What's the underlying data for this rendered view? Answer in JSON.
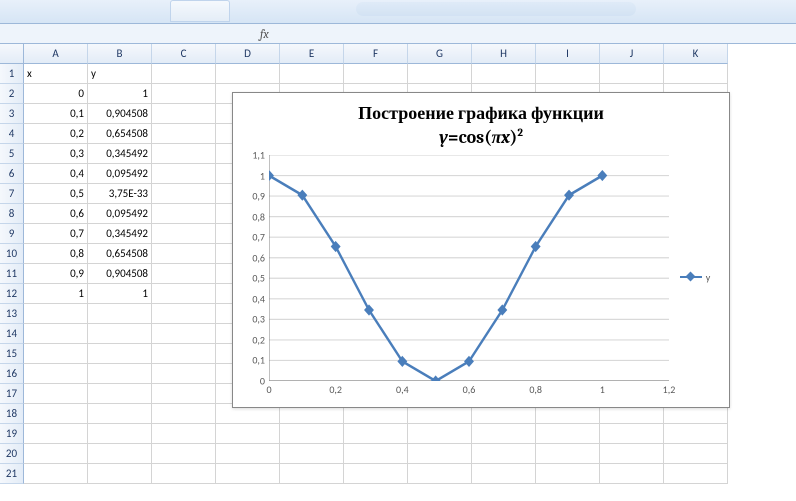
{
  "formula_bar_label": "fx",
  "columns": [
    "A",
    "B",
    "C",
    "D",
    "E",
    "F",
    "G",
    "H",
    "I",
    "J",
    "K"
  ],
  "row_count": 21,
  "headers": {
    "x": "x",
    "y": "y"
  },
  "data": [
    {
      "x": "0",
      "y": "1"
    },
    {
      "x": "0,1",
      "y": "0,904508"
    },
    {
      "x": "0,2",
      "y": "0,654508"
    },
    {
      "x": "0,3",
      "y": "0,345492"
    },
    {
      "x": "0,4",
      "y": "0,095492"
    },
    {
      "x": "0,5",
      "y": "3,75E-33"
    },
    {
      "x": "0,6",
      "y": "0,095492"
    },
    {
      "x": "0,7",
      "y": "0,345492"
    },
    {
      "x": "0,8",
      "y": "0,654508"
    },
    {
      "x": "0,9",
      "y": "0,904508"
    },
    {
      "x": "1",
      "y": "1"
    }
  ],
  "chart": {
    "title_line1": "Построение графика функции",
    "title_line2_prefix": "y",
    "title_line2_mid": "=cos(",
    "title_line2_pi": "π",
    "title_line2_x": "x",
    "title_line2_suffix": ")",
    "title_line2_exp": "2",
    "legend_label": "y"
  },
  "chart_data": {
    "type": "line",
    "title": "Построение графика функции y=cos(πx)^2",
    "xlabel": "",
    "ylabel": "",
    "xlim": [
      0,
      1.2
    ],
    "ylim": [
      0,
      1.1
    ],
    "x_ticks": [
      "0",
      "0,2",
      "0,4",
      "0,6",
      "0,8",
      "1",
      "1,2"
    ],
    "y_ticks": [
      "0",
      "0,1",
      "0,2",
      "0,3",
      "0,4",
      "0,5",
      "0,6",
      "0,7",
      "0,8",
      "0,9",
      "1",
      "1,1"
    ],
    "series": [
      {
        "name": "y",
        "color": "#4a7ebb",
        "marker": "diamond",
        "x": [
          0,
          0.1,
          0.2,
          0.3,
          0.4,
          0.5,
          0.6,
          0.7,
          0.8,
          0.9,
          1
        ],
        "y": [
          1,
          0.904508,
          0.654508,
          0.345492,
          0.095492,
          0,
          0.095492,
          0.345492,
          0.654508,
          0.904508,
          1
        ]
      }
    ]
  }
}
